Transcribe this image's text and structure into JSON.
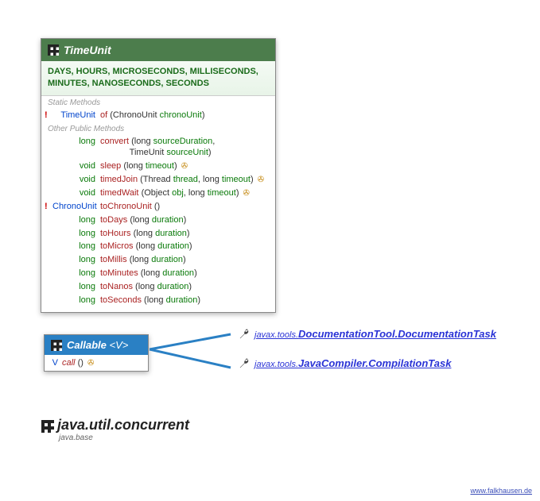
{
  "timeunit": {
    "name": "TimeUnit",
    "constants": "DAYS, HOURS, MICROSECONDS, MILLISECONDS, MINUTES, NANOSECONDS, SECONDS",
    "static_label": "Static Methods",
    "other_label": "Other Public Methods",
    "static_methods": [
      {
        "mark": "!",
        "ret": "TimeUnit",
        "ret_kind": "type",
        "name": "of",
        "params_html": "(ChronoUnit <span class=\"param-name\">chronoUnit</span>)",
        "trail": ""
      }
    ],
    "other_methods": [
      {
        "mark": "",
        "ret": "long",
        "ret_kind": "prim",
        "name": "convert",
        "params_html": "(long <span class=\"param-name\">sourceDuration</span>,<br>&nbsp;&nbsp;&nbsp;&nbsp;&nbsp;&nbsp;&nbsp;&nbsp;&nbsp;&nbsp;&nbsp;&nbsp;TimeUnit <span class=\"param-name\">sourceUnit</span>)",
        "trail": ""
      },
      {
        "mark": "",
        "ret": "void",
        "ret_kind": "void",
        "name": "sleep",
        "params_html": "(long <span class=\"param-name\">timeout</span>)",
        "trail": "✇"
      },
      {
        "mark": "",
        "ret": "void",
        "ret_kind": "void",
        "name": "timedJoin",
        "params_html": "(Thread <span class=\"param-name\">thread</span>, long <span class=\"param-name\">timeout</span>)",
        "trail": "✇"
      },
      {
        "mark": "",
        "ret": "void",
        "ret_kind": "void",
        "name": "timedWait",
        "params_html": "(Object <span class=\"param-name\">obj</span>, long <span class=\"param-name\">timeout</span>)",
        "trail": "✇"
      },
      {
        "mark": "!",
        "ret": "ChronoUnit",
        "ret_kind": "type",
        "name": "toChronoUnit",
        "params_html": "()",
        "trail": ""
      },
      {
        "mark": "",
        "ret": "long",
        "ret_kind": "prim",
        "name": "toDays",
        "params_html": "(long <span class=\"param-name\">duration</span>)",
        "trail": ""
      },
      {
        "mark": "",
        "ret": "long",
        "ret_kind": "prim",
        "name": "toHours",
        "params_html": "(long <span class=\"param-name\">duration</span>)",
        "trail": ""
      },
      {
        "mark": "",
        "ret": "long",
        "ret_kind": "prim",
        "name": "toMicros",
        "params_html": "(long <span class=\"param-name\">duration</span>)",
        "trail": ""
      },
      {
        "mark": "",
        "ret": "long",
        "ret_kind": "prim",
        "name": "toMillis",
        "params_html": "(long <span class=\"param-name\">duration</span>)",
        "trail": ""
      },
      {
        "mark": "",
        "ret": "long",
        "ret_kind": "prim",
        "name": "toMinutes",
        "params_html": "(long <span class=\"param-name\">duration</span>)",
        "trail": ""
      },
      {
        "mark": "",
        "ret": "long",
        "ret_kind": "prim",
        "name": "toNanos",
        "params_html": "(long <span class=\"param-name\">duration</span>)",
        "trail": ""
      },
      {
        "mark": "",
        "ret": "long",
        "ret_kind": "prim",
        "name": "toSeconds",
        "params_html": "(long <span class=\"param-name\">duration</span>)",
        "trail": ""
      }
    ]
  },
  "callable": {
    "name": "Callable",
    "type_param": "<V>",
    "ret": "V",
    "method": "call",
    "paren": " ()",
    "trail": "✇"
  },
  "links": {
    "prefix": "javax.tools.",
    "items": [
      "DocumentationTool.DocumentationTask",
      "JavaCompiler.CompilationTask"
    ]
  },
  "package": {
    "name": "java.util.concurrent",
    "module": "java.base"
  },
  "footer": "www.falkhausen.de"
}
